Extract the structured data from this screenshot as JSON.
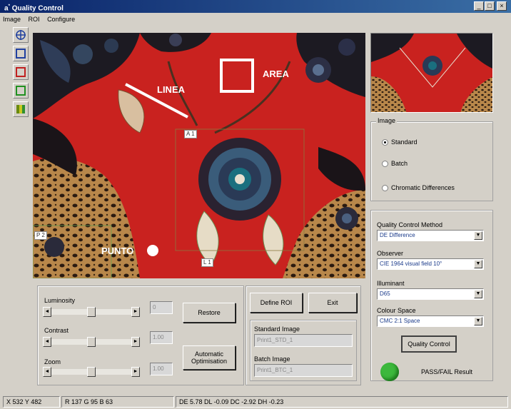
{
  "window": {
    "title": "Quality Control",
    "title_prefix": "a",
    "controls": {
      "minimize": "_",
      "maximize": "□",
      "close": "×"
    }
  },
  "menu": [
    "Image",
    "ROI",
    "Configure"
  ],
  "toolbar": {
    "tools": [
      {
        "name": "crosshair-tool",
        "color": "#1f3f9f"
      },
      {
        "name": "blue-square-tool",
        "color": "#2040a0"
      },
      {
        "name": "red-square-tool",
        "color": "#c02020"
      },
      {
        "name": "green-square-tool",
        "color": "#209020"
      },
      {
        "name": "gradient-tool",
        "color": "#808000"
      }
    ]
  },
  "canvas": {
    "annotations": {
      "linea": "LINEA",
      "area": "AREA",
      "punto": "PUNTO"
    },
    "roi_tags": [
      "A 1",
      "P 2",
      "L 1"
    ]
  },
  "image_group": {
    "label": "Image",
    "options": [
      {
        "label": "Standard",
        "selected": true
      },
      {
        "label": "Batch",
        "selected": false
      },
      {
        "label": "Chromatic Differences",
        "selected": false
      }
    ]
  },
  "qc_panel": {
    "method_label": "Quality Control Method",
    "method_value": "DE Difference",
    "observer_label": "Observer",
    "observer_value": "CIE 1964 visual field 10°",
    "illuminant_label": "Illuminant",
    "illuminant_value": "D65",
    "colour_space_label": "Colour Space",
    "colour_space_value": "CMC 2:1 Space",
    "qc_button": "Quality Control",
    "result_label": "PASS/FAIL Result",
    "result_color": "#3cb83c"
  },
  "adjust": {
    "luminosity_label": "Luminosity",
    "luminosity_value": "0",
    "luminosity_pos": 0.5,
    "contrast_label": "Contrast",
    "contrast_value": "1.00",
    "contrast_pos": 0.5,
    "zoom_label": "Zoom",
    "zoom_value": "1.00",
    "zoom_pos": 0.5,
    "restore_button": "Restore",
    "auto_button": "Automatic Optimisation"
  },
  "roi_panel": {
    "define_button": "Define ROI",
    "exit_button": "Exit",
    "standard_label": "Standard Image",
    "standard_value": "Print1_STD_1",
    "batch_label": "Batch Image",
    "batch_value": "Print1_BTC_1"
  },
  "status": {
    "coords": "X 532 Y 482",
    "rgb": "R 137 G 95 B 63",
    "diff": "DE 5.78 DL -0.09 DC -2.92 DH -0.23"
  }
}
